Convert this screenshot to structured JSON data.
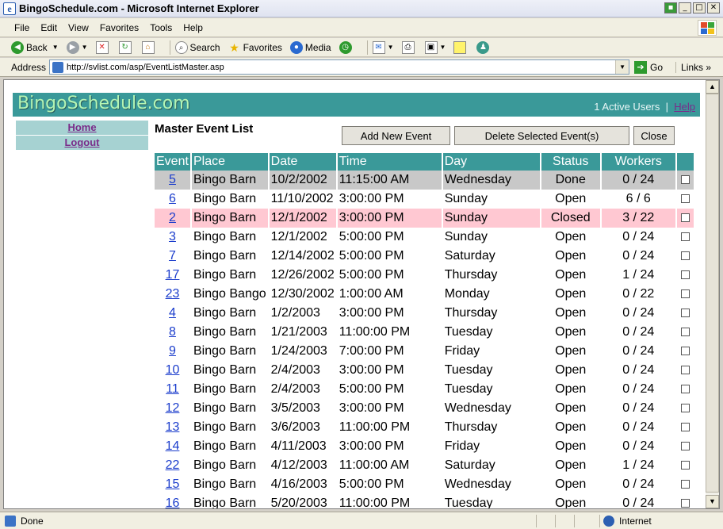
{
  "window": {
    "title": "BingoSchedule.com - Microsoft Internet Explorer",
    "controls": [
      "minimize",
      "maximize",
      "close"
    ]
  },
  "menubar": {
    "items": [
      "File",
      "Edit",
      "View",
      "Favorites",
      "Tools",
      "Help"
    ]
  },
  "toolbar": {
    "back_label": "Back",
    "search_label": "Search",
    "favorites_label": "Favorites",
    "media_label": "Media"
  },
  "addressbar": {
    "label": "Address",
    "url": "http://svlist.com/asp/EventListMaster.asp",
    "go_label": "Go",
    "links_label": "Links"
  },
  "site": {
    "logo": "BingoSchedule.com",
    "active_users": "1 Active Users",
    "separator": "|",
    "help_label": "Help"
  },
  "nav": {
    "home": "Home",
    "logout": "Logout"
  },
  "page": {
    "title": "Master Event List",
    "buttons": {
      "add": "Add New Event",
      "delete": "Delete Selected Event(s)",
      "close": "Close"
    }
  },
  "table": {
    "headers": [
      "Event",
      "Place",
      "Date",
      "Time",
      "Day",
      "Status",
      "Workers"
    ],
    "rows": [
      {
        "event": "5",
        "place": "Bingo Barn",
        "date": "10/2/2002",
        "time": "11:15:00 AM",
        "day": "Wednesday",
        "status": "Done",
        "workers": "0 / 24"
      },
      {
        "event": "6",
        "place": "Bingo Barn",
        "date": "11/10/2002",
        "time": "3:00:00 PM",
        "day": "Sunday",
        "status": "Open",
        "workers": "6 / 6"
      },
      {
        "event": "2",
        "place": "Bingo Barn",
        "date": "12/1/2002",
        "time": "3:00:00 PM",
        "day": "Sunday",
        "status": "Closed",
        "workers": "3 / 22"
      },
      {
        "event": "3",
        "place": "Bingo Barn",
        "date": "12/1/2002",
        "time": "5:00:00 PM",
        "day": "Sunday",
        "status": "Open",
        "workers": "0 / 24"
      },
      {
        "event": "7",
        "place": "Bingo Barn",
        "date": "12/14/2002",
        "time": "5:00:00 PM",
        "day": "Saturday",
        "status": "Open",
        "workers": "0 / 24"
      },
      {
        "event": "17",
        "place": "Bingo Barn",
        "date": "12/26/2002",
        "time": "5:00:00 PM",
        "day": "Thursday",
        "status": "Open",
        "workers": "1 / 24"
      },
      {
        "event": "23",
        "place": "Bingo Bango",
        "date": "12/30/2002",
        "time": "1:00:00 AM",
        "day": "Monday",
        "status": "Open",
        "workers": "0 / 22"
      },
      {
        "event": "4",
        "place": "Bingo Barn",
        "date": "1/2/2003",
        "time": "3:00:00 PM",
        "day": "Thursday",
        "status": "Open",
        "workers": "0 / 24"
      },
      {
        "event": "8",
        "place": "Bingo Barn",
        "date": "1/21/2003",
        "time": "11:00:00 PM",
        "day": "Tuesday",
        "status": "Open",
        "workers": "0 / 24"
      },
      {
        "event": "9",
        "place": "Bingo Barn",
        "date": "1/24/2003",
        "time": "7:00:00 PM",
        "day": "Friday",
        "status": "Open",
        "workers": "0 / 24"
      },
      {
        "event": "10",
        "place": "Bingo Barn",
        "date": "2/4/2003",
        "time": "3:00:00 PM",
        "day": "Tuesday",
        "status": "Open",
        "workers": "0 / 24"
      },
      {
        "event": "11",
        "place": "Bingo Barn",
        "date": "2/4/2003",
        "time": "5:00:00 PM",
        "day": "Tuesday",
        "status": "Open",
        "workers": "0 / 24"
      },
      {
        "event": "12",
        "place": "Bingo Barn",
        "date": "3/5/2003",
        "time": "3:00:00 PM",
        "day": "Wednesday",
        "status": "Open",
        "workers": "0 / 24"
      },
      {
        "event": "13",
        "place": "Bingo Barn",
        "date": "3/6/2003",
        "time": "11:00:00 PM",
        "day": "Thursday",
        "status": "Open",
        "workers": "0 / 24"
      },
      {
        "event": "14",
        "place": "Bingo Barn",
        "date": "4/11/2003",
        "time": "3:00:00 PM",
        "day": "Friday",
        "status": "Open",
        "workers": "0 / 24"
      },
      {
        "event": "22",
        "place": "Bingo Barn",
        "date": "4/12/2003",
        "time": "11:00:00 AM",
        "day": "Saturday",
        "status": "Open",
        "workers": "1 / 24"
      },
      {
        "event": "15",
        "place": "Bingo Barn",
        "date": "4/16/2003",
        "time": "5:00:00 PM",
        "day": "Wednesday",
        "status": "Open",
        "workers": "0 / 24"
      },
      {
        "event": "16",
        "place": "Bingo Barn",
        "date": "5/20/2003",
        "time": "11:00:00 PM",
        "day": "Tuesday",
        "status": "Open",
        "workers": "0 / 24"
      }
    ]
  },
  "statusbar": {
    "text": "Done",
    "zone": "Internet"
  },
  "colors": {
    "teal": "#3a9999",
    "done_row": "#c8c8c8",
    "closed_row": "#ffc8d2",
    "link": "#1a3ccc",
    "visited": "#7a2c8a"
  }
}
